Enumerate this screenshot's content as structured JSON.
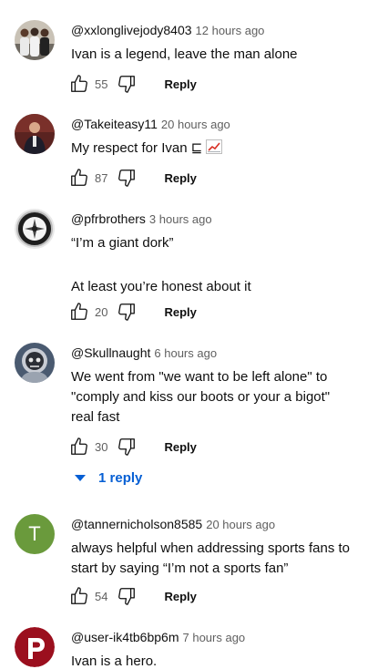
{
  "comments": [
    {
      "handle": "@xxlonglivejody8403",
      "time": "12 hours ago",
      "lines": [
        "Ivan is a legend, leave the man alone"
      ],
      "likes": "55",
      "reply_label": "Reply",
      "avatar": "group-photo"
    },
    {
      "handle": "@Takeiteasy11",
      "time": "20 hours ago",
      "lines": [
        "My respect for Ivan ⊑"
      ],
      "emoji": "chart-increasing-emoji",
      "likes": "87",
      "reply_label": "Reply",
      "avatar": "person-photo"
    },
    {
      "handle": "@pfrbrothers",
      "time": "3 hours ago",
      "lines": [
        "“I’m a giant dork”",
        "",
        "At least you’re honest about it"
      ],
      "likes": "20",
      "reply_label": "Reply",
      "avatar": "round-logo"
    },
    {
      "handle": "@Skullnaught",
      "time": "6 hours ago",
      "lines": [
        "We went from \"we want to be left alone\" to",
        "\"comply and kiss our boots or your a bigot\"",
        "real fast"
      ],
      "likes": "30",
      "reply_label": "Reply",
      "avatar": "skull-astronaut"
    },
    {
      "handle": "@tannernicholson8585",
      "time": "20 hours ago",
      "lines": [
        "always helpful when addressing sports fans to",
        "start by saying “I’m not a sports fan”"
      ],
      "likes": "54",
      "reply_label": "Reply",
      "avatar": "letter",
      "avatar_letter": "T"
    },
    {
      "handle": "@user-ik4tb6bp6m",
      "time": "7 hours ago",
      "lines": [
        "Ivan is a hero."
      ],
      "avatar": "phillies-p"
    }
  ],
  "replies_toggle": {
    "label": "1 reply"
  },
  "colors": {
    "link_blue": "#065fd4",
    "letter_avatar_green": "#6a9a3c",
    "phillies_red": "#9b0f1e"
  },
  "icons": {
    "like": "thumb-up-icon",
    "dislike": "thumb-down-icon",
    "replies": "caret-down-icon"
  }
}
